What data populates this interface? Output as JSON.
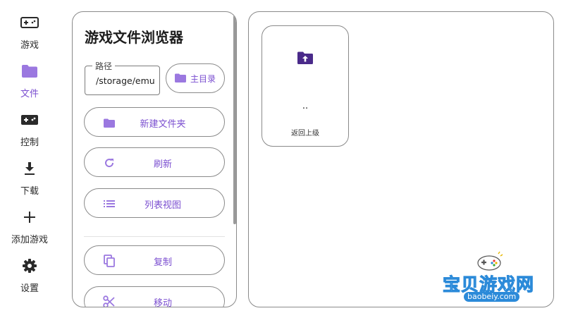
{
  "nav": {
    "items": [
      {
        "label": "游戏",
        "icon": "gamepad-icon",
        "active": false
      },
      {
        "label": "文件",
        "icon": "folder-icon",
        "active": true
      },
      {
        "label": "控制",
        "icon": "controller-icon",
        "active": false
      },
      {
        "label": "下载",
        "icon": "download-icon",
        "active": false
      },
      {
        "label": "添加游戏",
        "icon": "plus-icon",
        "active": false
      },
      {
        "label": "设置",
        "icon": "gear-icon",
        "active": false
      }
    ]
  },
  "side_panel": {
    "title": "游戏文件浏览器",
    "path_label": "路径",
    "path_value": "/storage/emu",
    "home_label": "主目录",
    "actions": [
      {
        "label": "新建文件夹",
        "icon": "folder-icon"
      },
      {
        "label": "刷新",
        "icon": "refresh-icon"
      },
      {
        "label": "列表视图",
        "icon": "list-icon"
      },
      {
        "label": "复制",
        "icon": "copy-icon"
      },
      {
        "label": "移动",
        "icon": "scissors-icon"
      }
    ]
  },
  "files": [
    {
      "name": "..",
      "caption": "返回上级",
      "icon": "folder-up-icon"
    }
  ],
  "watermark": {
    "text": "宝贝游戏网",
    "domain": "baobeiy.com"
  },
  "colors": {
    "accent": "#7b4fd0",
    "accent_dark": "#4a2a8a",
    "border": "#8a8a8a",
    "watermark_blue": "#2b8ad9"
  }
}
